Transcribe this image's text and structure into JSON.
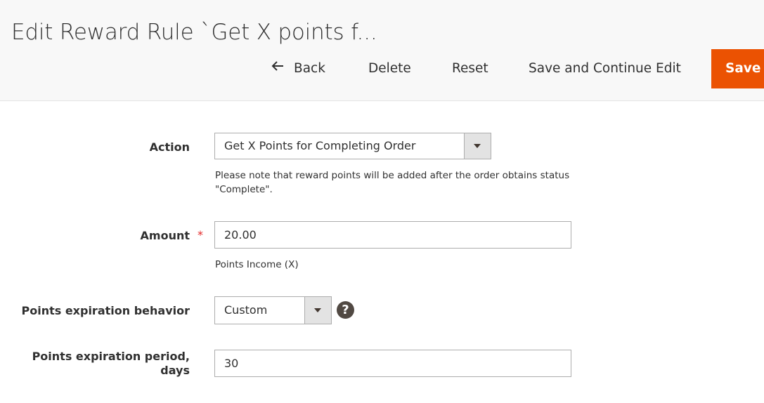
{
  "header": {
    "title": "Edit Reward Rule `Get X points f...",
    "back_label": "Back",
    "delete_label": "Delete",
    "reset_label": "Reset",
    "save_continue_label": "Save and Continue Edit",
    "save_label": "Save"
  },
  "form": {
    "action": {
      "label": "Action",
      "value": "Get X Points for Completing Order",
      "note_line1": "Please note that reward points will be added after the order obtains status",
      "note_line2": "\"Complete\"."
    },
    "amount": {
      "label": "Amount",
      "required_marker": "*",
      "value": "20.00",
      "note": "Points Income (X)"
    },
    "expiration_behavior": {
      "label": "Points expiration behavior",
      "value": "Custom",
      "help_glyph": "?"
    },
    "expiration_period": {
      "label_line1": "Points expiration period,",
      "label_line2": "days",
      "value": "30"
    }
  },
  "colors": {
    "primary_button": "#eb5202",
    "header_bg": "#f8f8f8",
    "required": "#e22626"
  },
  "icons": {
    "back": "arrow-left-icon",
    "dropdown": "chevron-down-icon",
    "help": "help-circle-icon"
  }
}
